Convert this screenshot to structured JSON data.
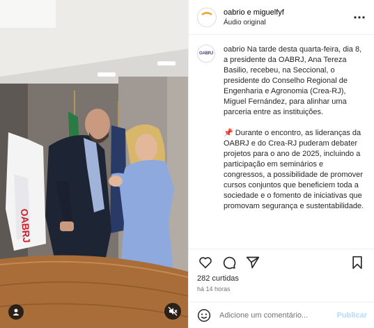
{
  "post": {
    "author_line": "oabrio e miguelfyf",
    "audio": "Áudio original",
    "avatar_text": "OABRJ",
    "caption_user": "oabrio",
    "caption_p1": " Na tarde desta quarta-feira, dia 8, a presidente da OABRJ, Ana Tereza Basilio, recebeu, na Seccional, o presidente do Conselho Regional de Engenharia e Agronomia (Crea-RJ), Miguel Fernández, para alinhar uma parceria entre as instituições.",
    "caption_pin": "📌",
    "caption_p2": " Durante o encontro, as lideranças da OABRJ e do Crea-RJ puderam debater projetos para o ano de 2025, incluindo a participação em seminários e congressos, a possibilidade de promover cursos conjuntos que beneficiem toda a sociedade e o fomento de iniciativas que promovam segurança e sustentabilidade.",
    "likes": "282 curtidas",
    "time": "há 14 horas",
    "comment_placeholder": "Adicione um comentário...",
    "publish_label": "Publicar"
  },
  "media": {
    "flag_text": "OABRJ"
  },
  "icons": {
    "more": "more-horizontal-icon",
    "like": "heart-icon",
    "comment": "comment-icon",
    "share": "share-icon",
    "save": "bookmark-icon",
    "emoji": "emoji-icon",
    "user_tag": "user-tag-icon",
    "mute": "muted-speaker-icon"
  },
  "colors": {
    "publish": "#b3dbff",
    "border": "#efefef",
    "muted_text": "#737373"
  }
}
